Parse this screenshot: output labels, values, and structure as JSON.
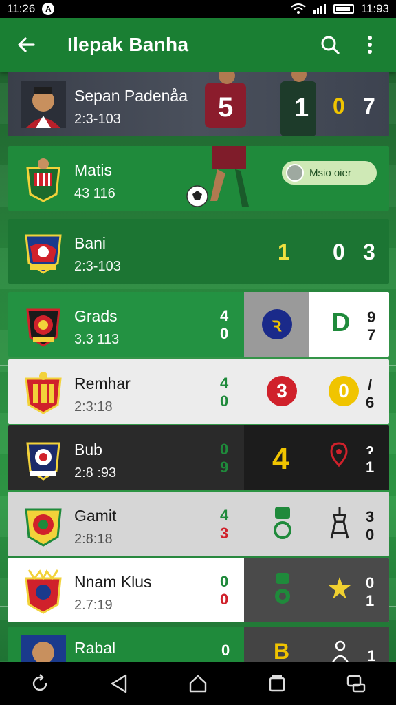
{
  "status_bar": {
    "time": "11:26",
    "right_time": "11:93",
    "a_badge": "A"
  },
  "app_bar": {
    "title": "Ilepak Banha"
  },
  "rows": [
    {
      "name": "Sepan Padenåa",
      "sub": "2:3-103",
      "score_a": "0",
      "score_b": "7",
      "back_num": "5",
      "keeper_num": "1"
    },
    {
      "name": "Matis",
      "sub": "43 116",
      "chip_label": "Msio oier"
    },
    {
      "name": "Bani",
      "sub": "2:3-103",
      "col1": "1",
      "col2": "0",
      "col3": "3"
    },
    {
      "name": "Grads",
      "sub": "3.3 113",
      "s_top": "4",
      "s_bot": "0",
      "badge": "ꝛ",
      "letter": "D",
      "e_top": "9",
      "e_bot": "7"
    },
    {
      "name": "Remhar",
      "sub": "2:3:18",
      "s_top": "4",
      "s_bot": "0",
      "badge": "3",
      "badge2": "0",
      "e_top": "/",
      "e_bot": "6"
    },
    {
      "name": "Bub",
      "sub": "2:8 :93",
      "s_top": "0",
      "s_bot": "9",
      "big": "4",
      "e_top": "ɂ",
      "e_bot": "1"
    },
    {
      "name": "Gamit",
      "sub": "2:8:18",
      "s_top": "4",
      "s_bot": "3",
      "e_top": "3",
      "e_bot": "0"
    },
    {
      "name": "Nnam Klus",
      "sub": "2.7:19",
      "s_top": "0",
      "s_bot": "0",
      "e_top": "0",
      "e_bot": "1"
    },
    {
      "name": "Rabal",
      "sub": "",
      "s_top": "0",
      "letter": "B",
      "e_bot": "1"
    }
  ],
  "colors": {
    "app_green": "#1a7f33",
    "accent_yellow": "#f0c400",
    "red": "#d0212b"
  }
}
